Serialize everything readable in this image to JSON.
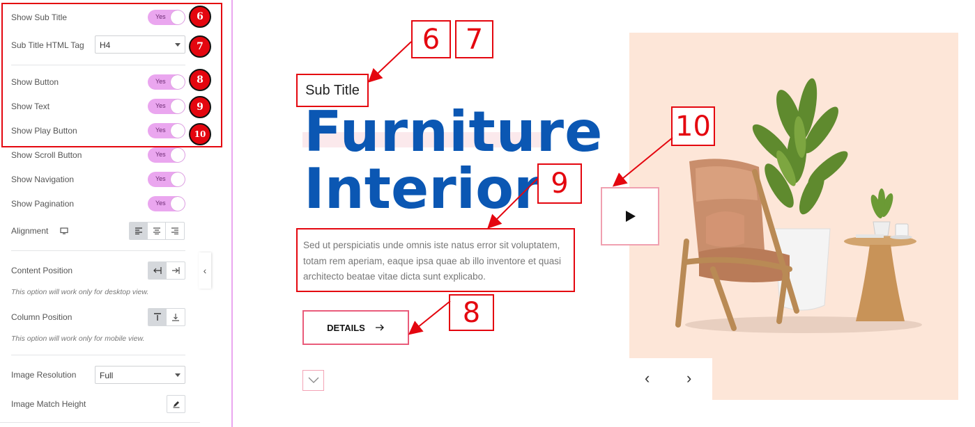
{
  "settings": {
    "rows": [
      {
        "label": "Show Sub Title",
        "type": "toggle",
        "value": "Yes",
        "badge": "6"
      },
      {
        "label": "Sub Title HTML Tag",
        "type": "select",
        "value": "H4",
        "badge": "7"
      },
      {
        "label": "Show Button",
        "type": "toggle",
        "value": "Yes",
        "badge": "8"
      },
      {
        "label": "Show Text",
        "type": "toggle",
        "value": "Yes",
        "badge": "9"
      },
      {
        "label": "Show Play Button",
        "type": "toggle",
        "value": "Yes",
        "badge": "10"
      },
      {
        "label": "Show Scroll Button",
        "type": "toggle",
        "value": "Yes"
      },
      {
        "label": "Show Navigation",
        "type": "toggle",
        "value": "Yes"
      },
      {
        "label": "Show Pagination",
        "type": "toggle",
        "value": "Yes"
      },
      {
        "label": "Alignment",
        "type": "buttons"
      },
      {
        "label": "Content Position",
        "type": "buttons"
      },
      {
        "label": "Column Position",
        "type": "buttons"
      },
      {
        "label": "Image Resolution",
        "type": "select",
        "value": "Full"
      },
      {
        "label": "Image Match Height",
        "type": "edit"
      }
    ],
    "content_position_note": "This option will work only for desktop view.",
    "column_position_note": "This option will work only for mobile view."
  },
  "preview": {
    "subtitle": "Sub Title",
    "title_line1": "Furniture",
    "title_line2": "Interior",
    "description": "Sed ut perspiciatis unde omnis iste natus error sit voluptatem, totam rem aperiam, eaque ipsa quae ab illo inventore et quasi architecto beatae vitae dicta sunt explicabo.",
    "button_label": "DETAILS",
    "callouts": {
      "n6": "6",
      "n7": "7",
      "n8": "8",
      "n9": "9",
      "n10": "10"
    }
  },
  "icons": {
    "alignment": [
      "align-left-icon",
      "align-center-icon",
      "align-right-icon"
    ],
    "content_position": [
      "content-start-icon",
      "content-end-icon"
    ],
    "column_position": [
      "column-top-icon",
      "column-bottom-icon"
    ],
    "device": "desktop-icon",
    "edit": "pencil-icon",
    "play": "play-icon",
    "scroll": "chevron-down-icon",
    "nav": [
      "chevron-left-icon",
      "chevron-right-icon"
    ],
    "button_arrow": "arrow-right-icon"
  },
  "colors": {
    "accent_red": "#e4060f",
    "toggle_pink": "#eaa6ef",
    "title_blue": "#0b57b3",
    "image_bg": "#fde6d8"
  }
}
